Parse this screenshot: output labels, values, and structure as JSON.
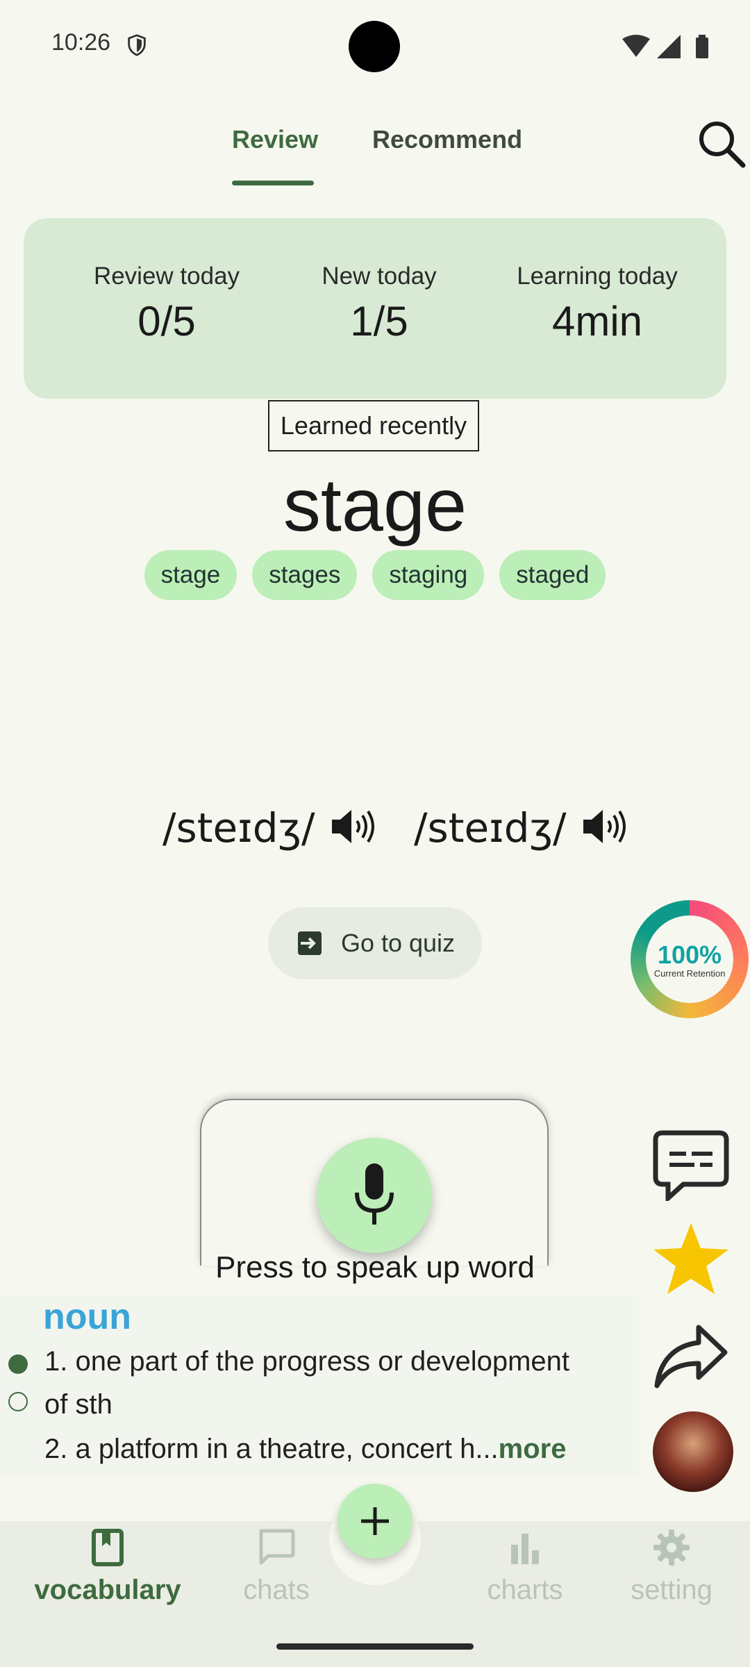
{
  "status_bar": {
    "time": "10:26"
  },
  "tabs": [
    {
      "label": "Review",
      "active": true
    },
    {
      "label": "Recommend",
      "active": false
    }
  ],
  "stats": [
    {
      "label": "Review today",
      "value": "0/5"
    },
    {
      "label": "New today",
      "value": "1/5"
    },
    {
      "label": "Learning today",
      "value": "4min"
    }
  ],
  "word": {
    "badge": "Learned recently",
    "headword": "stage",
    "forms": [
      "stage",
      "stages",
      "staging",
      "staged"
    ],
    "pronunciations": [
      "/steɪdʒ/",
      "/steɪdʒ/"
    ]
  },
  "quiz_button": {
    "label": "Go to quiz"
  },
  "retention": {
    "value": "100%",
    "label": "Current Retention"
  },
  "speak": {
    "label": "Press to speak up word"
  },
  "definition": {
    "part_of_speech": "noun",
    "lines": [
      "1. one part of the progress or development",
      "of sth",
      "2. a platform in a theatre, concert h..."
    ],
    "more": "more"
  },
  "bottom_nav": [
    {
      "label": "vocabulary",
      "icon": "bookmark-book-icon",
      "active": true
    },
    {
      "label": "chats",
      "icon": "chat-bubble-icon",
      "active": false
    },
    {
      "label": "charts",
      "icon": "bar-chart-icon",
      "active": false
    },
    {
      "label": "setting",
      "icon": "gear-icon",
      "active": false
    }
  ],
  "colors": {
    "primary": "#3e6b3f",
    "chip": "#bceeb7",
    "card": "#d8ead4",
    "background": "#f6f8f0",
    "pos": "#3aa4d8",
    "star": "#f7c600",
    "retention": "#10a3a2"
  }
}
